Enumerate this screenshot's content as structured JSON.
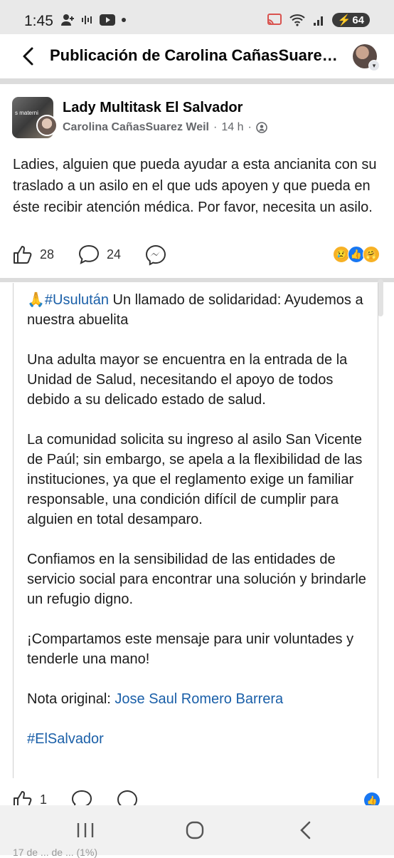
{
  "status_bar": {
    "time": "1:45",
    "left_icons": [
      "person-add-icon",
      "voicemail-icon",
      "youtube-icon",
      "dot-icon"
    ],
    "right_icons": [
      "cast-icon",
      "wifi-icon",
      "signal-icon"
    ],
    "battery": "64"
  },
  "header": {
    "title": "Publicación de Carolina CañasSuarez Weil"
  },
  "post": {
    "group_name": "Lady Multitask El Salvador",
    "group_avatar_text": "s materni",
    "author": "Carolina CañasSuarez Weil",
    "separator": "·",
    "time": "14 h",
    "privacy_icon": "friends-icon",
    "text": "Ladies, alguien que pueda ayudar a esta ancianita con su traslado a un asilo en el que uds apoyen y que pueda en éste recibir atención médica. Por favor, necesita un asilo.",
    "likes": "28",
    "comments": "24",
    "reactions": [
      "sad",
      "like",
      "care"
    ]
  },
  "shared": {
    "emoji": "🙏",
    "hashtag1": "#Usulután",
    "intro": " Un llamado de solidaridad: Ayudemos a nuestra abuelita",
    "p1": "Una adulta mayor se encuentra en la entrada de la Unidad de Salud, necesitando el apoyo de todos debido a su delicado estado de salud.",
    "p2": "La comunidad solicita su ingreso al asilo San Vicente de Paúl; sin embargo, se apela a la flexibilidad de las instituciones, ya que el reglamento exige un familiar responsable, una condición difícil de cumplir para alguien en total desamparo.",
    "p3": "Confiamos en la sensibilidad de las entidades de servicio social para encontrar una solución y brindarle un refugio digno.",
    "p4": "¡Compartamos este mensaje para unir voluntades y tenderle una mano!",
    "note_label": "Nota original: ",
    "note_link": "Jose Saul Romero Barrera",
    "hashtag2": "#ElSalvador"
  },
  "shared_actions": {
    "likes": "1"
  },
  "nav": {
    "peek": "17 de ... de ... (1%)"
  }
}
